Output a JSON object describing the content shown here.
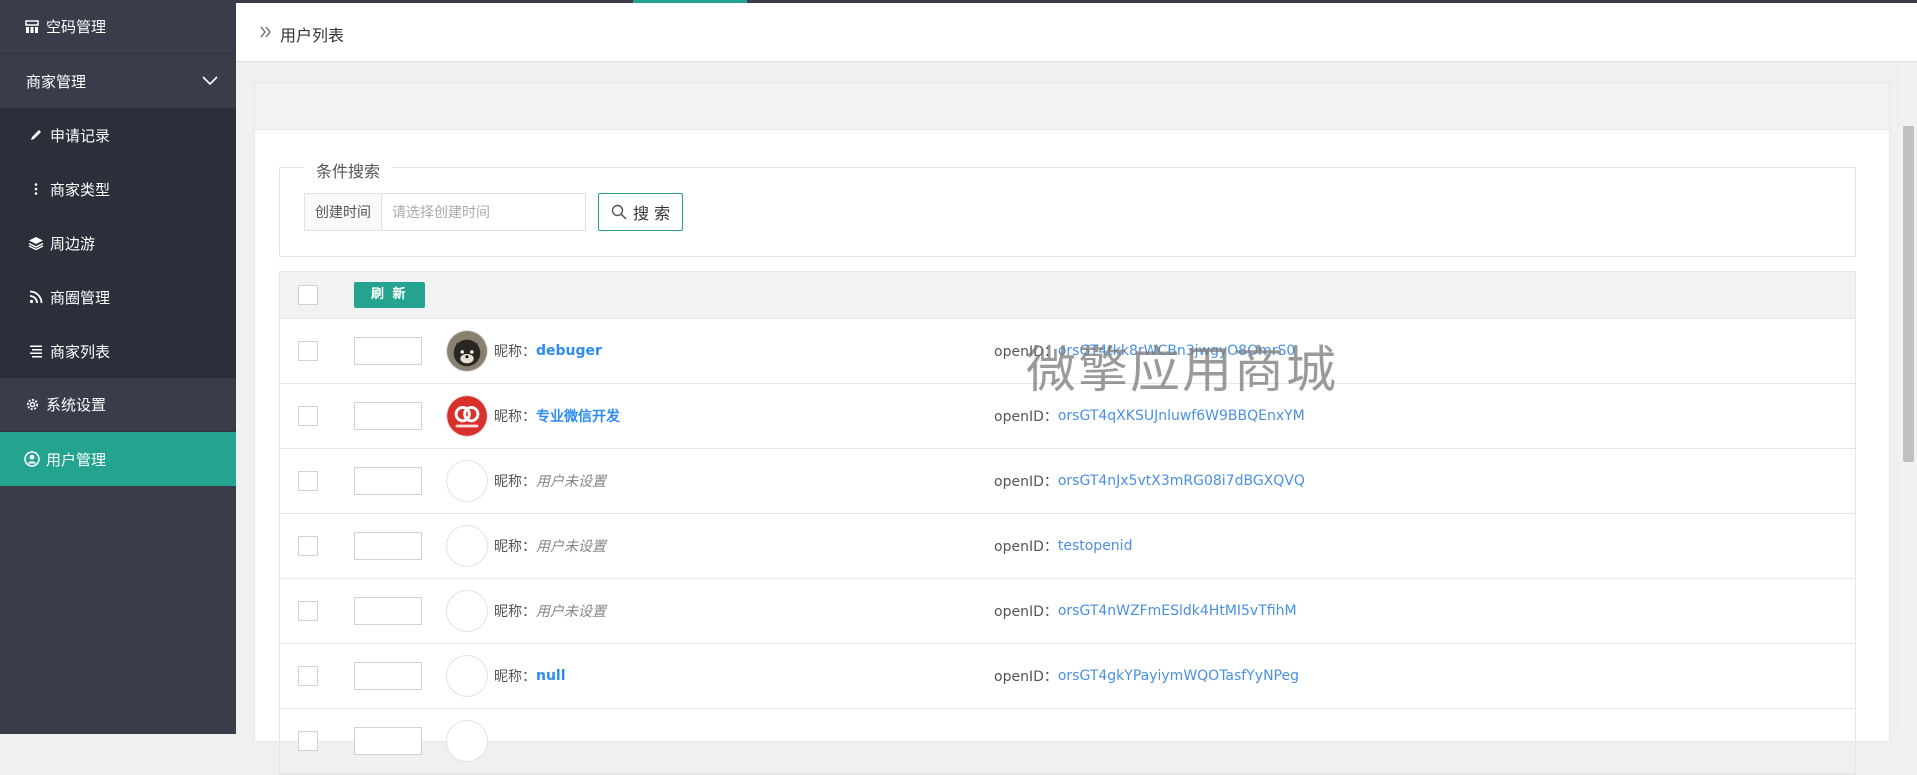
{
  "sidebar": {
    "items": [
      {
        "label": "空码管理",
        "icon": "grid-icon"
      },
      {
        "label": "商家管理",
        "icon": "chevron-down-icon"
      },
      {
        "label": "申请记录",
        "icon": "pencil-icon"
      },
      {
        "label": "商家类型",
        "icon": "vertical-dots-icon"
      },
      {
        "label": "周边游",
        "icon": "layers-icon"
      },
      {
        "label": "商圈管理",
        "icon": "rss-icon"
      },
      {
        "label": "商家列表",
        "icon": "list-icon"
      },
      {
        "label": "系统设置",
        "icon": "gear-icon"
      },
      {
        "label": "用户管理",
        "icon": "user-circle-icon"
      }
    ],
    "colors": {
      "bg": "#393d49",
      "sub_bg": "#2b2f3a",
      "active": "#24a490"
    }
  },
  "breadcrumb": {
    "title": "用户列表",
    "icon": "double-chevron-right-icon"
  },
  "search": {
    "legend": "条件搜索",
    "label": "创建时间",
    "placeholder": "请选择创建时间",
    "button": "搜 索"
  },
  "table": {
    "refresh": "刷 新",
    "nickname_label": "昵称：",
    "openid_label": "openID：",
    "rows": [
      {
        "nickname": "debuger",
        "unset": false,
        "openid": "orsGT4tkk8rWCBn3jwgyO8OmrS0",
        "avatar": "dog-photo"
      },
      {
        "nickname": "专业微信开发",
        "unset": false,
        "openid": "orsGT4qXKSUJnluwf6W9BBQEnxYM",
        "avatar": "red-logo"
      },
      {
        "nickname": "用户未设置",
        "unset": true,
        "openid": "orsGT4nJx5vtX3mRG08i7dBGXQVQ",
        "avatar": "empty"
      },
      {
        "nickname": "用户未设置",
        "unset": true,
        "openid": "testopenid",
        "avatar": "empty"
      },
      {
        "nickname": "用户未设置",
        "unset": true,
        "openid": "orsGT4nWZFmESldk4HtMI5vTfihM",
        "avatar": "empty"
      },
      {
        "nickname": "null",
        "unset": false,
        "openid": "orsGT4gkYPayiymWQOTasfYyNPeg",
        "avatar": "empty"
      }
    ]
  },
  "watermark": "微擎应用商城",
  "accent_color": "#24a490"
}
